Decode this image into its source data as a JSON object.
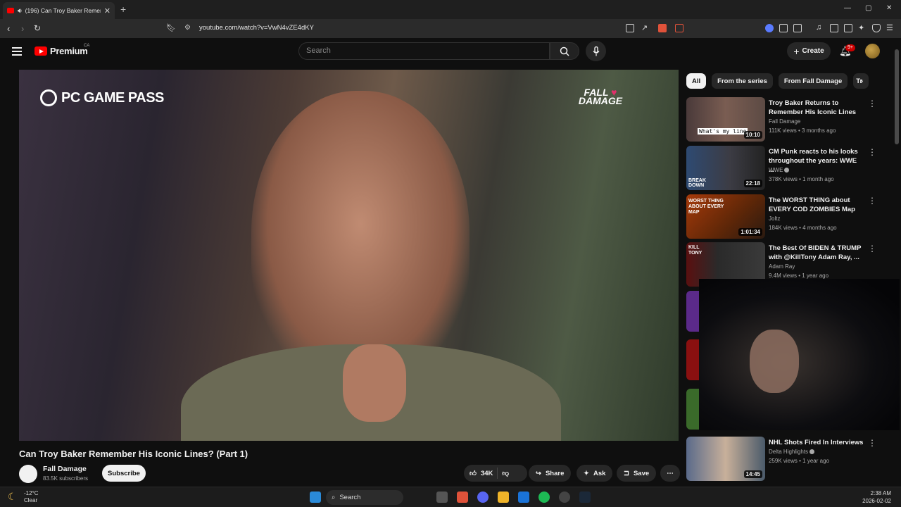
{
  "browser": {
    "tab_title": "(196) Can Troy Baker Rememb",
    "tab_close": "✕",
    "new_tab": "+",
    "url": "youtube.com/watch?v=VwN4vZE4dKY",
    "win_min": "—",
    "win_max": "▢",
    "win_close": "✕"
  },
  "header": {
    "logo_text": "Premium",
    "country_code": "CA",
    "search_placeholder": "Search",
    "create_label": "Create",
    "notif_count": "9+"
  },
  "player": {
    "overlay_left": "PC GAME PASS",
    "overlay_right_line1": "FALL",
    "overlay_right_line2": "DAMAGE"
  },
  "video": {
    "title": "Can Troy Baker Remember His Iconic Lines? (Part 1)",
    "channel": "Fall Damage",
    "subscribers": "83.5K subscribers",
    "subscribe_label": "Subscribe",
    "likes": "34K",
    "share_label": "Share",
    "ask_label": "Ask",
    "save_label": "Save"
  },
  "chips": [
    "All",
    "From the series",
    "From Fall Damage",
    "Tr"
  ],
  "recommendations": [
    {
      "title": "Troy Baker Returns to Remember His Iconic Lines",
      "channel": "Fall Damage",
      "meta": "111K views • 3 months ago",
      "duration": "10:10",
      "verified": false
    },
    {
      "title": "CM Punk reacts to his looks throughout the years: WWE ...",
      "channel": "WWE",
      "meta": "378K views • 1 month ago",
      "duration": "22:18",
      "verified": true
    },
    {
      "title": "The WORST THING about EVERY COD ZOMBIES Map",
      "channel": "Joltz",
      "meta": "184K views • 4 months ago",
      "duration": "1:01:34",
      "verified": false
    },
    {
      "title": "The Best Of BIDEN & TRUMP with @KillTony Adam Ray, ...",
      "channel": "Adam Ray",
      "meta": "9.4M views • 1 year ago",
      "duration": "",
      "verified": false
    },
    {
      "title": "NHL Shots Fired In Interviews",
      "channel": "Delta Highlights",
      "meta": "259K views • 1 year ago",
      "duration": "14:45",
      "verified": true
    }
  ],
  "thumb_captions": {
    "rec1": "What's my line",
    "rec2": "BREAK DOWN",
    "rec3": "WORST THING ABOUT EVERY MAP",
    "rec4": "KILL TONY"
  },
  "taskbar": {
    "temperature": "-12°C",
    "condition": "Clear",
    "search_label": "Search",
    "time": "2:38 AM",
    "date": "2026-02-02"
  },
  "colors": {
    "youtube_red": "#ff0000",
    "background": "#0f0f0f",
    "chip_bg": "#272727"
  }
}
